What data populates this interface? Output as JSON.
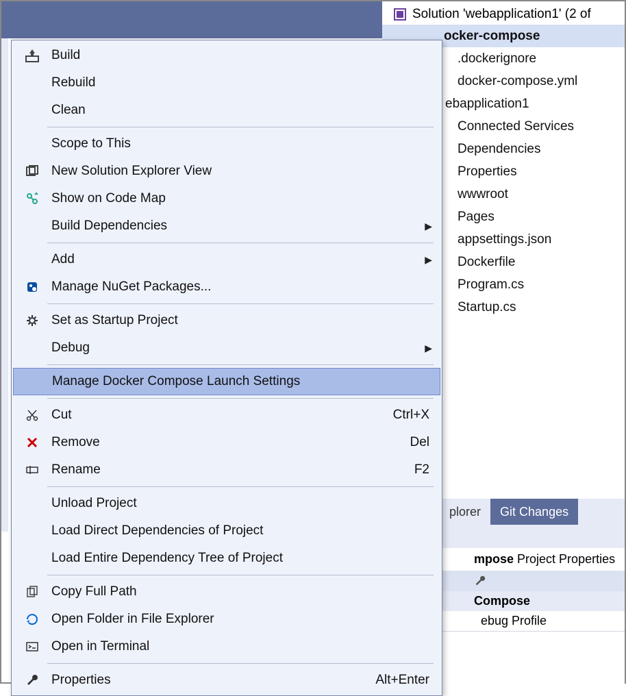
{
  "solution": {
    "header": "Solution 'webapplication1' (2 of ",
    "project_bold": "ocker-compose",
    "items": [
      ".dockerignore",
      "docker-compose.yml",
      "ebapplication1",
      "Connected Services",
      "Dependencies",
      "Properties",
      "wwwroot",
      "Pages",
      "appsettings.json",
      "Dockerfile",
      "Program.cs",
      "Startup.cs"
    ]
  },
  "tabs": {
    "explorer": "plorer",
    "git": "Git Changes"
  },
  "properties": {
    "title_bold": "mpose",
    "title_rest": " Project Properties",
    "section": "Compose",
    "row": "ebug Profile"
  },
  "menu": {
    "build": "Build",
    "rebuild": "Rebuild",
    "clean": "Clean",
    "scope": "Scope to This",
    "newview": "New Solution Explorer View",
    "codemap": "Show on Code Map",
    "builddeps": "Build Dependencies",
    "add": "Add",
    "nuget": "Manage NuGet Packages...",
    "startup": "Set as Startup Project",
    "debug": "Debug",
    "compose": "Manage Docker Compose Launch Settings",
    "cut": "Cut",
    "cut_key": "Ctrl+X",
    "remove": "Remove",
    "remove_key": "Del",
    "rename": "Rename",
    "rename_key": "F2",
    "unload": "Unload Project",
    "loaddirect": "Load Direct Dependencies of Project",
    "loadtree": "Load Entire Dependency Tree of Project",
    "copypath": "Copy Full Path",
    "openfolder": "Open Folder in File Explorer",
    "terminal": "Open in Terminal",
    "properties": "Properties",
    "properties_key": "Alt+Enter"
  }
}
